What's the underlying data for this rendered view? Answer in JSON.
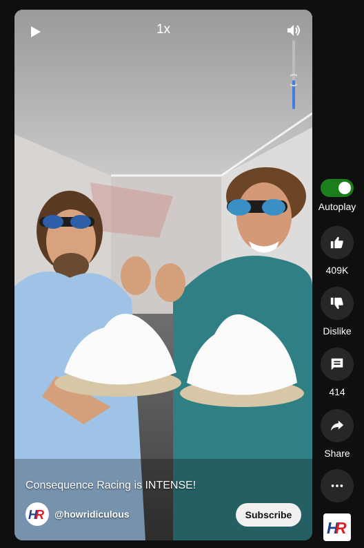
{
  "player": {
    "speed_label": "1x",
    "volume_level": 0.42,
    "caption": "Consequence Racing is INTENSE!",
    "channel": "@howridiculous",
    "subscribe_label": "Subscribe",
    "channel_logo_text": "HR"
  },
  "rail": {
    "autoplay_label": "Autoplay",
    "autoplay_on": true,
    "like_count": "409K",
    "dislike_label": "Dislike",
    "comment_count": "414",
    "share_label": "Share"
  },
  "colors": {
    "background": "#0f0f0f",
    "toggle_on": "#1a7f1a",
    "logo_red": "#e31b23",
    "logo_blue": "#1c3f94",
    "volume_fill": "#3e7fe0"
  },
  "icons": [
    "play-icon",
    "volume-icon",
    "thumb-up-icon",
    "thumb-down-icon",
    "comment-icon",
    "share-icon",
    "more-icon"
  ]
}
